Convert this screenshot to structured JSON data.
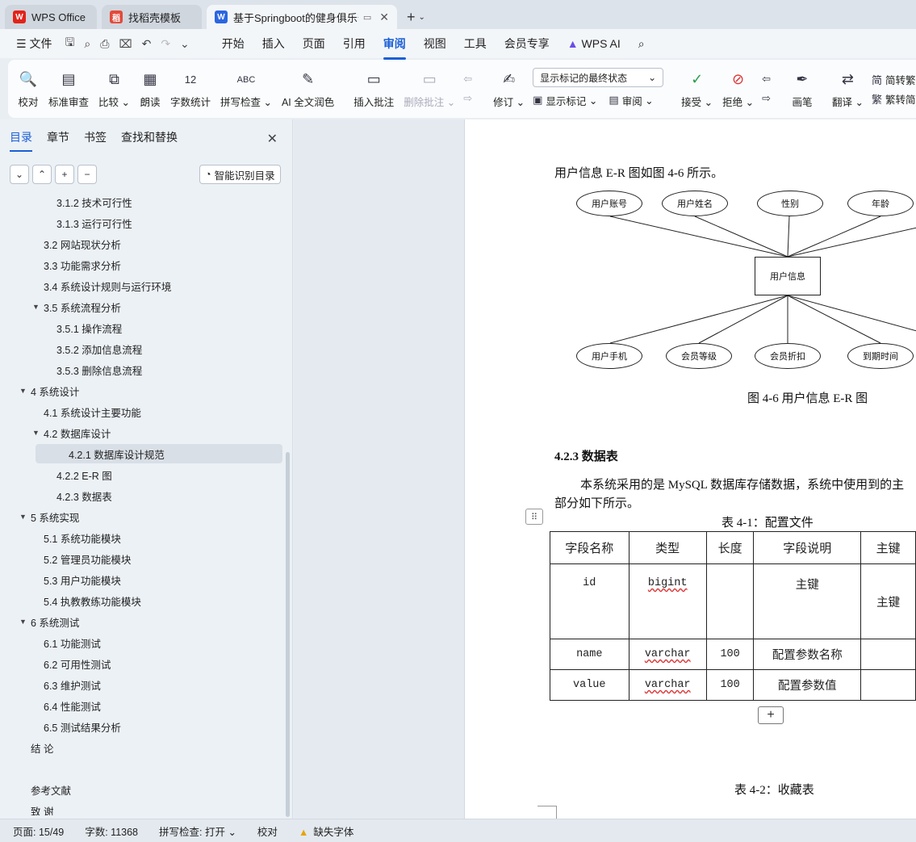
{
  "tabs": [
    {
      "label": "WPS Office",
      "icon": "wps-logo-icon",
      "color": "#e2231a"
    },
    {
      "label": "找稻壳模板",
      "icon": "docer-icon",
      "color": "#e34a3a"
    },
    {
      "label": "基于Springboot的健身俱乐部",
      "icon": "writer-doc-icon",
      "color": "#2b66e0",
      "active": true
    }
  ],
  "menu": {
    "file": "文件",
    "items": [
      "开始",
      "插入",
      "页面",
      "引用",
      "审阅",
      "视图",
      "工具",
      "会员专享"
    ],
    "active": "审阅",
    "wps_ai": "WPS AI"
  },
  "ribbon": {
    "proofread": "校对",
    "standard_review": "标准审查",
    "compare": "比较",
    "read_aloud": "朗读",
    "word_count": "字数统计",
    "spell_check": "拼写检查",
    "ai_polish": "AI 全文润色",
    "insert_comment": "插入批注",
    "delete_comment": "删除批注",
    "track_changes": "修订",
    "markup_mode": "显示标记的最终状态",
    "show_markup": "显示标记",
    "review_pane": "审阅",
    "accept": "接受",
    "reject": "拒绝",
    "ink": "画笔",
    "translate": "翻译",
    "to_traditional": "简转繁",
    "to_simplified": "繁转简"
  },
  "nav": {
    "tabs": [
      "目录",
      "章节",
      "书签",
      "查找和替换"
    ],
    "active_tab": "目录",
    "smart_toc": "智能识别目录",
    "toc": [
      {
        "label": "3.1.2  技术可行性",
        "level": 3
      },
      {
        "label": "3.1.3  运行可行性",
        "level": 3
      },
      {
        "label": "3.2  网站现状分析",
        "level": 2
      },
      {
        "label": "3.3  功能需求分析",
        "level": 2
      },
      {
        "label": "3.4  系统设计规则与运行环境",
        "level": 2
      },
      {
        "label": "3.5 系统流程分析",
        "level": 2,
        "expand": true
      },
      {
        "label": "3.5.1 操作流程",
        "level": 3
      },
      {
        "label": "3.5.2 添加信息流程",
        "level": 3
      },
      {
        "label": "3.5.3 删除信息流程",
        "level": 3
      },
      {
        "label": "4  系统设计",
        "level": 1,
        "expand": true
      },
      {
        "label": "4.1  系统设计主要功能",
        "level": 2
      },
      {
        "label": "4.2  数据库设计",
        "level": 2,
        "expand": true
      },
      {
        "label": "4.2.1  数据库设计规范",
        "level": 3,
        "selected": true
      },
      {
        "label": "4.2.2 E-R 图",
        "level": 3
      },
      {
        "label": "4.2.3  数据表",
        "level": 3
      },
      {
        "label": "5  系统实现",
        "level": 1,
        "expand": true
      },
      {
        "label": "5.1    系统功能模块",
        "level": 2
      },
      {
        "label": "5.2    管理员功能模块",
        "level": 2
      },
      {
        "label": "5.3    用户功能模块",
        "level": 2
      },
      {
        "label": "5.4    执教教练功能模块",
        "level": 2
      },
      {
        "label": "6  系统测试",
        "level": 1,
        "expand": true
      },
      {
        "label": "6.1  功能测试",
        "level": 2
      },
      {
        "label": "6.2  可用性测试",
        "level": 2
      },
      {
        "label": "6.3  维护测试",
        "level": 2
      },
      {
        "label": "6.4  性能测试",
        "level": 2
      },
      {
        "label": "6.5  测试结果分析",
        "level": 2
      },
      {
        "label": "结  论",
        "level": 1
      },
      {
        "label": "",
        "level": 1
      },
      {
        "label": "参考文献",
        "level": 1
      },
      {
        "label": "致  谢",
        "level": 1
      }
    ]
  },
  "doc": {
    "er_intro": "用户信息 E-R 图如图 4-6 所示。",
    "er_entity": "用户信息",
    "er_attrs_top": [
      "用户账号",
      "用户姓名",
      "性别",
      "年龄"
    ],
    "er_attrs_bottom": [
      "用户手机",
      "会员等级",
      "会员折扣",
      "到期时间"
    ],
    "er_caption": "图 4-6 用户信息 E-R 图",
    "section_heading": "4.2.3  数据表",
    "para_line1": "本系统采用的是 MySQL 数据库存储数据，系统中使用到的主",
    "para_line2": "部分如下所示。",
    "table1_caption": "表 4-1：配置文件",
    "table1_headers": [
      "字段名称",
      "类型",
      "长度",
      "字段说明",
      "主键"
    ],
    "table1_rows": [
      [
        "id",
        "bigint",
        "",
        "主键",
        "主键"
      ],
      [
        "name",
        "varchar",
        "100",
        "配置参数名称",
        ""
      ],
      [
        "value",
        "varchar",
        "100",
        "配置参数值",
        ""
      ]
    ],
    "table2_caption": "表 4-2：收藏表"
  },
  "status": {
    "page": "页面: 15/49",
    "words": "字数: 11368",
    "spell": "拼写检查: 打开",
    "proof": "校对",
    "missing_font": "缺失字体"
  }
}
